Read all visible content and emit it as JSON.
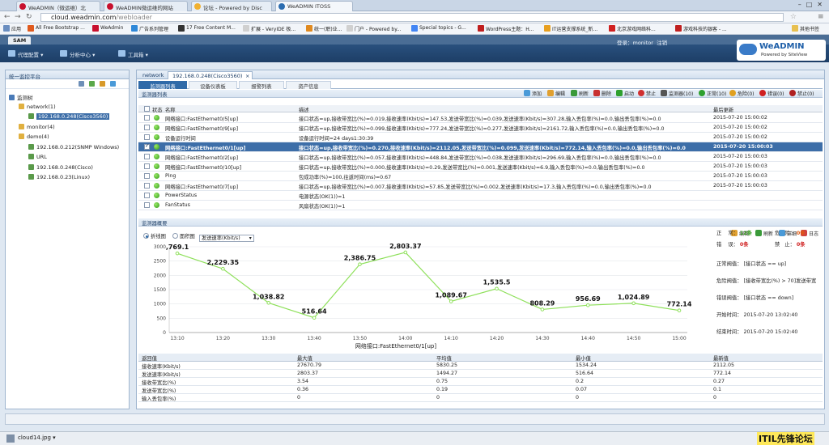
{
  "browser": {
    "tabs": [
      {
        "label": "WeADMIN（微运维）北",
        "active": false
      },
      {
        "label": "WeADMIN微运维的网站",
        "active": false
      },
      {
        "label": "论坛 - Powered by Disc",
        "active": false
      },
      {
        "label": "WeADMIN ITOSS",
        "active": true
      }
    ],
    "url_host": "cloud.weadmin.com",
    "url_path": "/webloader",
    "bookmarks": [
      "应用",
      "All Free Bootstrap ...",
      "WeAdmin",
      "广告系列管理",
      "17 Free Content M...",
      "扩展 - VeryIDE 极...",
      "统一(职)业...",
      "门户 - Powered by...",
      "Special topics - G...",
      "WordPress主题：H...",
      "IT运营支撑系统_新...",
      "北京游戏网络科...",
      "游戏科技的银客 - ...",
      "其他书签"
    ]
  },
  "app": {
    "tab": "SAM",
    "user_label": "登录：monitor",
    "logout_label": "注销",
    "menus": [
      "代理配置",
      "分析中心",
      "工具箱"
    ],
    "logo_title": "WeADMIN",
    "logo_sub": "Powered by SiteView"
  },
  "left": {
    "title": "统一监控平台",
    "tree": [
      {
        "label": "监测树",
        "level": 0,
        "icon": "group"
      },
      {
        "label": "network(1)",
        "level": 1,
        "icon": "folder"
      },
      {
        "label": "192.168.0.248(Cisco3560)",
        "level": 2,
        "icon": "device",
        "selected": true
      },
      {
        "label": "monitor(4)",
        "level": 1,
        "icon": "folder"
      },
      {
        "label": "demo(4)",
        "level": 1,
        "icon": "folder"
      },
      {
        "label": "192.168.0.212(SNMP Windows)",
        "level": 2,
        "icon": "device"
      },
      {
        "label": "URL",
        "level": 2,
        "icon": "device"
      },
      {
        "label": "192.168.0.248(Cisco)",
        "level": 2,
        "icon": "device"
      },
      {
        "label": "192.168.0.23(Linux)",
        "level": 2,
        "icon": "device"
      }
    ]
  },
  "right": {
    "tabs": [
      "network",
      "192.168.0.248(Cisco3560)"
    ],
    "subtabs": [
      "监测器列表",
      "设备仪表板",
      "报警列表",
      "资产信息"
    ],
    "list_title": "监测器列表",
    "toolbar": [
      "添加",
      "编辑",
      "刷新",
      "删除",
      "启动",
      "禁止",
      "监测器(10)",
      "正常(10)",
      "危险(0)",
      "错误(0)",
      "禁止(0)"
    ],
    "cols": [
      "状态",
      "名称",
      "描述",
      "最后更新"
    ],
    "rows": [
      {
        "name": "网络接口:FastEthernet0/5[up]",
        "desc": "接口状态=up,接收带宽比(%)=0.019,接收速率(Kbit/s)=147.53,发送带宽比(%)=0.039,发送速率(Kbit/s)=307.28,输入丢包率(%)=0.0,输出丢包率(%)=0.0",
        "time": "2015-07-20 15:00:02",
        "checked": false
      },
      {
        "name": "网络接口:FastEthernet0/9[up]",
        "desc": "接口状态=up,接收带宽比(%)=0.099,接收速率(Kbit/s)=777.24,发送带宽比(%)=0.277,发送速率(Kbit/s)=2161.72,输入丢包率(%)=0.0,输出丢包率(%)=0.0",
        "time": "2015-07-20 15:00:02",
        "checked": false
      },
      {
        "name": "设备运行时间",
        "desc": "设备运行时间=24 days1:30:39",
        "time": "2015-07-20 15:00:02",
        "checked": false
      },
      {
        "name": "网络接口:FastEthernet0/1[up]",
        "desc": "接口状态=up,接收带宽比(%)=0.270,接收速率(Kbit/s)=2112.05,发送带宽比(%)=0.099,发送速率(Kbit/s)=772.14,输入丢包率(%)=0.0,输出丢包率(%)=0.0",
        "time": "2015-07-20 15:00:03",
        "checked": true,
        "selected": true
      },
      {
        "name": "网络接口:FastEthernet0/2[up]",
        "desc": "接口状态=up,接收带宽比(%)=0.057,接收速率(Kbit/s)=448.84,发送带宽比(%)=0.038,发送速率(Kbit/s)=296.69,输入丢包率(%)=0.0,输出丢包率(%)=0.0",
        "time": "2015-07-20 15:00:03",
        "checked": false
      },
      {
        "name": "网络接口:FastEthernet0/10[up]",
        "desc": "接口状态=up,接收带宽比(%)=0.000,接收速率(Kbit/s)=0.29,发送带宽比(%)=0.001,发送速率(Kbit/s)=6.9,输入丢包率(%)=0.0,输出丢包率(%)=0.0",
        "time": "2015-07-20 15:00:03",
        "checked": false
      },
      {
        "name": "Ping",
        "desc": "包成功率(%)=100,往返时间(ms)=0.67",
        "time": "2015-07-20 15:00:03",
        "checked": false
      },
      {
        "name": "网络接口:FastEthernet0/7[up]",
        "desc": "接口状态=up,接收带宽比(%)=0.007,接收速率(Kbit/s)=57.85,发送带宽比(%)=0.002,发送速率(Kbit/s)=17.3,输入丢包率(%)=0.0,输出丢包率(%)=0.0",
        "time": "2015-07-20 15:00:03",
        "checked": false
      },
      {
        "name": "PowerStatus",
        "desc": "电源状态(OK(1))=1",
        "time": "",
        "checked": false
      },
      {
        "name": "FanStatus",
        "desc": "风扇状态(OK(1))=1",
        "time": "",
        "checked": false
      }
    ],
    "overview_title": "监测器概要",
    "overview_actions": [
      "编辑",
      "刷新",
      "详细",
      "日志"
    ],
    "radio": {
      "line": "折线图",
      "area": "面积图",
      "select_value": "发送速率(Kbit/s)"
    },
    "stats": {
      "normal_label": "正",
      "normal_label2": "常：",
      "normal_val": "12条",
      "danger_label": "危",
      "danger_label2": "险：",
      "danger_val": "0条",
      "error_label": "错",
      "error_label2": "误：",
      "error_val": "0条",
      "disabled_label": "禁",
      "disabled_label2": "止：",
      "disabled_val": "0条",
      "normal_thr_label": "正常阀值：",
      "normal_thr": "[接口状态 == up]",
      "danger_thr_label": "危险阀值：",
      "danger_thr": "[接收带宽比(%) > 70]发送带宽",
      "error_thr_label": "错误阀值：",
      "error_thr": "[接口状态 == down]",
      "start_label": "开始时间：",
      "start": "2015-07-20 13:02:40",
      "end_label": "结束时间：",
      "end": "2015-07-20 15:02:40"
    },
    "summary": {
      "headers": [
        "返回值",
        "最大值",
        "平均值",
        "最小值",
        "最新值"
      ],
      "rows": [
        [
          "接收速率(Kbit/s)",
          "27670.79",
          "5830.25",
          "1534.24",
          "2112.05"
        ],
        [
          "发送速率(Kbit/s)",
          "2803.37",
          "1494.27",
          "516.64",
          "772.14"
        ],
        [
          "接收带宽比(%)",
          "3.54",
          "0.75",
          "0.2",
          "0.27"
        ],
        [
          "发送带宽比(%)",
          "0.36",
          "0.19",
          "0.07",
          "0.1"
        ],
        [
          "输入丢包率(%)",
          "0",
          "0",
          "0",
          "0"
        ]
      ]
    }
  },
  "download": {
    "file": "cloud14.jpg"
  },
  "watermark": "ITIL先锋论坛",
  "chart_data": {
    "type": "line",
    "xlabel": "网络接口:FastEthernet0/1[up]",
    "ylabel": "",
    "ylim": [
      0,
      3000
    ],
    "yticks": [
      0,
      500,
      1000,
      1500,
      2000,
      2500,
      3000
    ],
    "xticks": [
      "13:10",
      "13:20",
      "13:30",
      "13:40",
      "13:50",
      "14:00",
      "14:10",
      "14:20",
      "14:30",
      "14:40",
      "14:50",
      "15:00"
    ],
    "series": [
      {
        "x": [
          "13:10",
          "13:20",
          "13:30",
          "13:40",
          "13:50",
          "14:00",
          "14:10",
          "14:20",
          "14:30",
          "14:40",
          "14:50",
          "15:00"
        ],
        "values": [
          2769.1,
          2229.35,
          1038.82,
          516.64,
          2386.75,
          2803.37,
          1089.67,
          1535.5,
          808.29,
          956.69,
          1024.89,
          772.14
        ],
        "labels": [
          ",769.1",
          "2,229.35",
          "1,038.82",
          "516.64",
          "2,386.75",
          "2,803.37",
          "1,089.67",
          "1,535.5",
          "808.29",
          "956.69",
          "1,024.89",
          "772.14"
        ]
      }
    ],
    "color": "#8ee05a",
    "grid": true
  }
}
